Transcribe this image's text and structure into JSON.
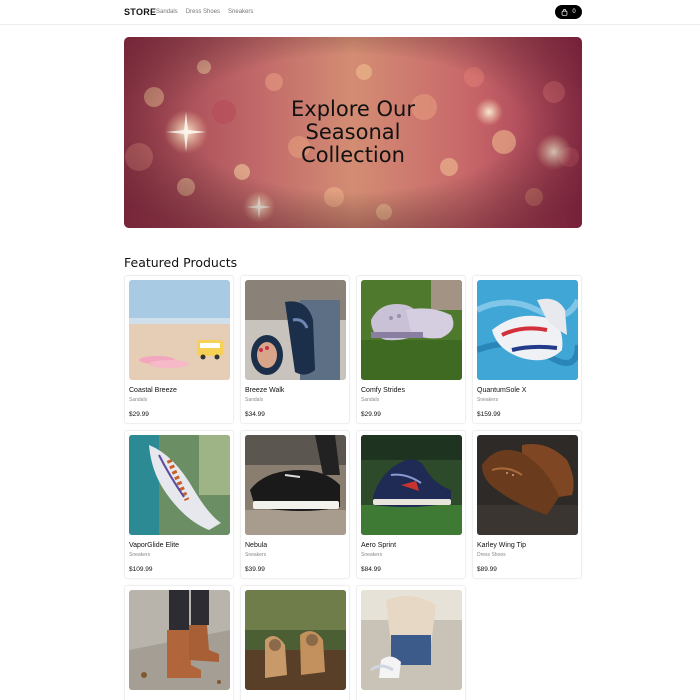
{
  "header": {
    "brand": "STORE",
    "nav": [
      "Sandals",
      "Dress Shoes",
      "Sneakers"
    ],
    "cart_count": "0",
    "cart_icon": "shopping-bag-icon"
  },
  "hero": {
    "title": "Explore Our\nSeasonal\nCollection"
  },
  "featured": {
    "title": "Featured Products",
    "products": [
      {
        "name": "Coastal Breeze",
        "category": "Sandals",
        "price": "$29.99"
      },
      {
        "name": "Breeze Walk",
        "category": "Sandals",
        "price": "$34.99"
      },
      {
        "name": "Comfy Strides",
        "category": "Sandals",
        "price": "$29.99"
      },
      {
        "name": "QuantumSole X",
        "category": "Sneakers",
        "price": "$159.99"
      },
      {
        "name": "VaporGlide Elite",
        "category": "Sneakers",
        "price": "$109.99"
      },
      {
        "name": "Nebula",
        "category": "Sneakers",
        "price": "$39.99"
      },
      {
        "name": "Aero Sprint",
        "category": "Sneakers",
        "price": "$84.99"
      },
      {
        "name": "Karley Wing Tip",
        "category": "Dress Shoes",
        "price": "$89.99"
      },
      {
        "name": "",
        "category": "",
        "price": ""
      },
      {
        "name": "",
        "category": "",
        "price": ""
      },
      {
        "name": "",
        "category": "",
        "price": ""
      }
    ]
  }
}
